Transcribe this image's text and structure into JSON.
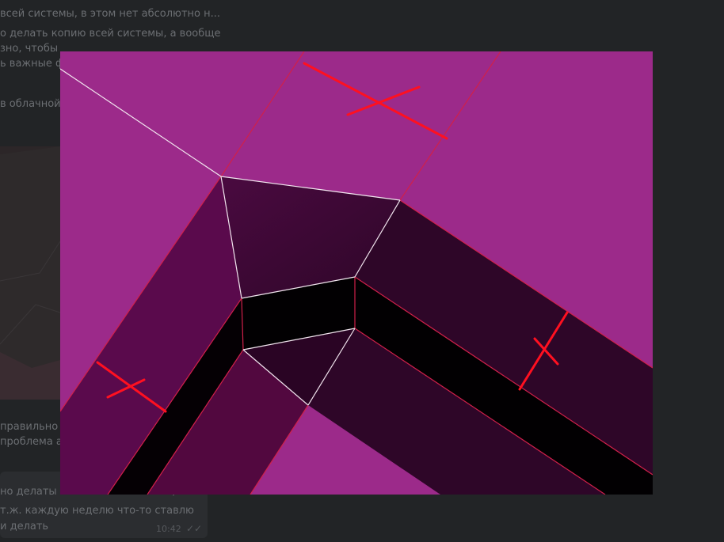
{
  "chat": {
    "lines_top": [
      "всей системы, в этом нет абсолютно н...",
      "о делать копию всей системы, а вообще",
      "зно, чтобы откатывать состояния при",
      "ь важные фа",
      "в облачной"
    ],
    "lines_mid": [
      "правильно с",
      "проблема ак"
    ],
    "lines_bottom": [
      "но делаты копию всей системы, а вообщ",
      "т.ж. каждую неделю что-то ставлю",
      "и делать"
    ],
    "timestamp": "10:42",
    "read_icon": "double-check-icon"
  },
  "viewer": {
    "colors": {
      "background": "#9c2a8a",
      "dark_face": "#5a0a4c",
      "darker_face": "#300628",
      "black_face": "#020002",
      "edge_red": "#d0204a",
      "edge_white": "#f2e6ef",
      "mark_red": "#ff1020"
    }
  }
}
